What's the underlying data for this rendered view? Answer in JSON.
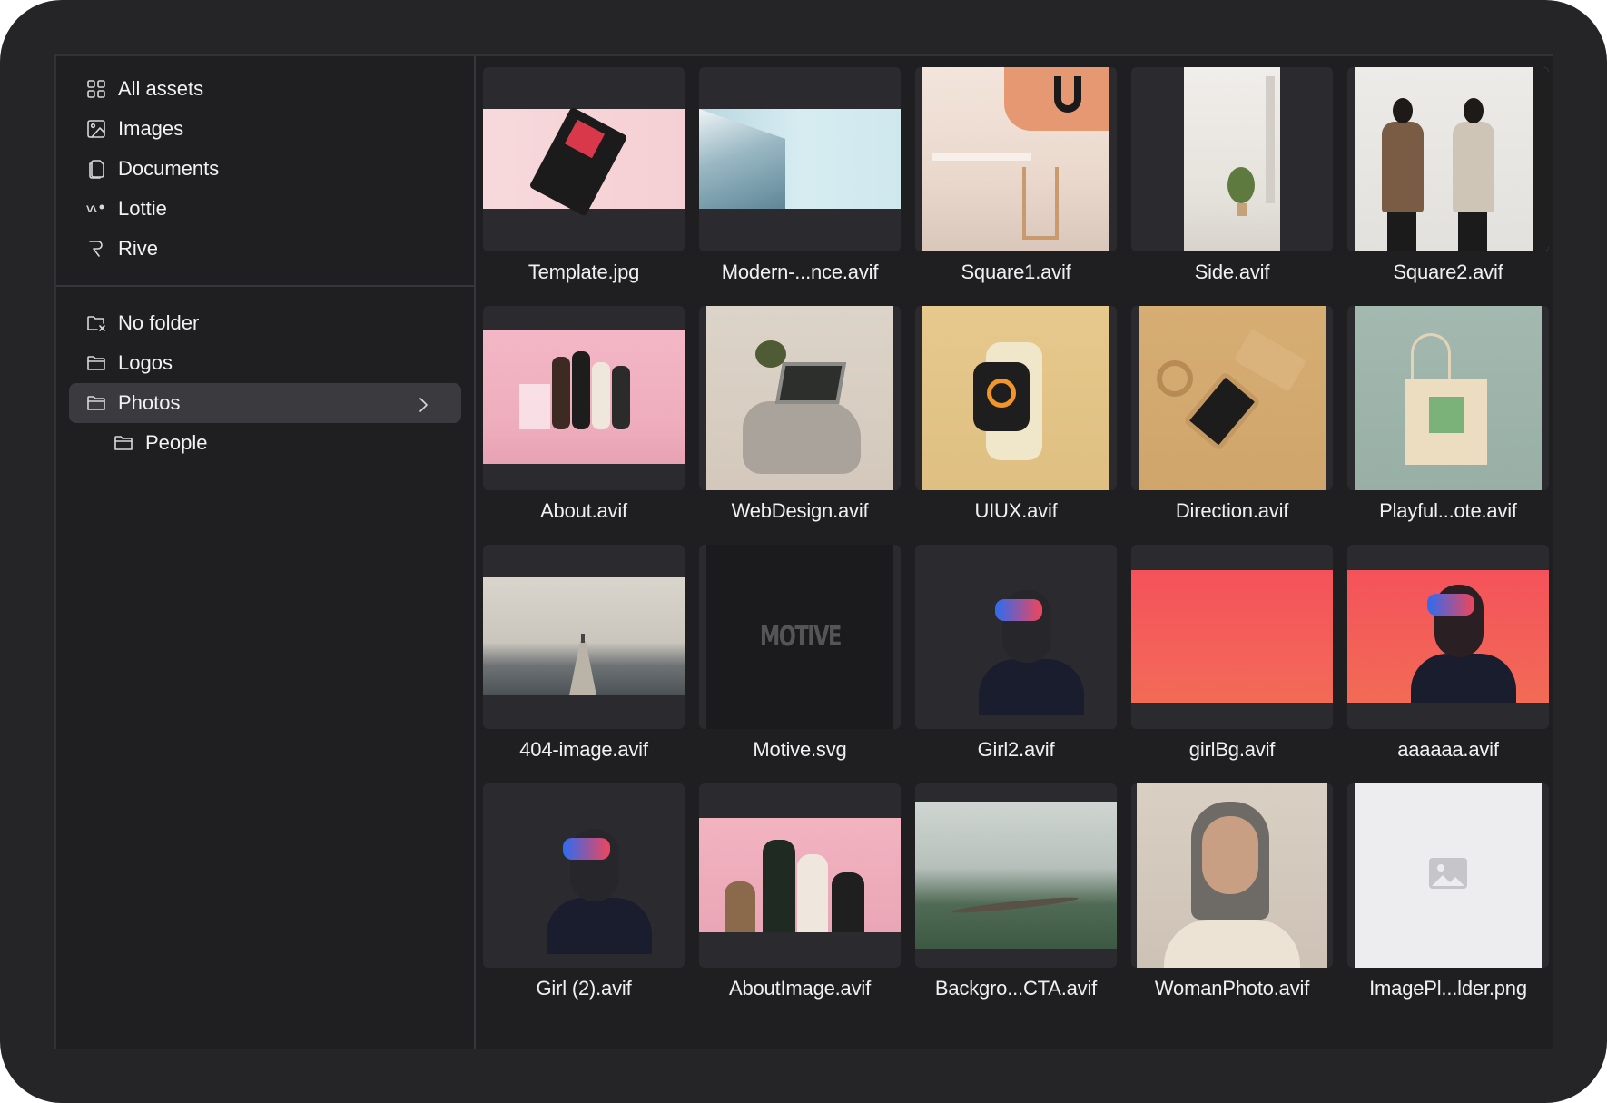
{
  "sidebar": {
    "nav": [
      {
        "label": "All assets",
        "icon": "grid-icon"
      },
      {
        "label": "Images",
        "icon": "image-icon"
      },
      {
        "label": "Documents",
        "icon": "documents-icon"
      },
      {
        "label": "Lottie",
        "icon": "lottie-icon"
      },
      {
        "label": "Rive",
        "icon": "rive-icon"
      }
    ],
    "folders": [
      {
        "label": "No folder",
        "icon": "folder-x-icon"
      },
      {
        "label": "Logos",
        "icon": "folder-icon"
      },
      {
        "label": "Photos",
        "icon": "folder-icon",
        "selected": true,
        "has_chevron": "chevron-right-icon"
      },
      {
        "label": "People",
        "icon": "folder-icon",
        "nested": true
      }
    ]
  },
  "assets": [
    {
      "name": "Template.jpg"
    },
    {
      "name": "Modern-...nce.avif"
    },
    {
      "name": "Square1.avif"
    },
    {
      "name": "Side.avif"
    },
    {
      "name": "Square2.avif"
    },
    {
      "name": "About.avif"
    },
    {
      "name": "WebDesign.avif"
    },
    {
      "name": "UIUX.avif"
    },
    {
      "name": "Direction.avif"
    },
    {
      "name": "Playful...ote.avif"
    },
    {
      "name": "404-image.avif"
    },
    {
      "name": "Motive.svg",
      "thumb_text": "MOTIVE"
    },
    {
      "name": "Girl2.avif"
    },
    {
      "name": "girlBg.avif"
    },
    {
      "name": "aaaaaa.avif"
    },
    {
      "name": "Girl (2).avif"
    },
    {
      "name": "AboutImage.avif"
    },
    {
      "name": "Backgro...CTA.avif"
    },
    {
      "name": "WomanPhoto.avif"
    },
    {
      "name": "ImagePl...lder.png"
    }
  ],
  "colors": {
    "background": "#252528",
    "panel": "#1f1f22",
    "selected": "#3a3a3f",
    "text": "#f2f2f2"
  }
}
